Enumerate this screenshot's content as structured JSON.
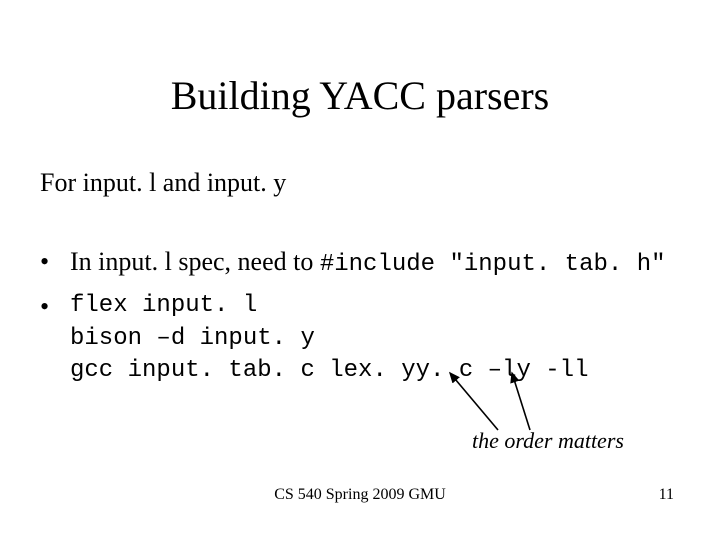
{
  "title": "Building YACC parsers",
  "subtitle": "For input. l and input. y",
  "bullets": [
    {
      "prefix": "In input. l spec, need to ",
      "code": "#include \"input. tab. h\""
    },
    {
      "code_block": "flex input. l\nbison –d input. y\ngcc input. tab. c lex. yy. c –ly -ll"
    }
  ],
  "note": "the order matters",
  "footer": "CS 540 Spring 2009 GMU",
  "page": "11"
}
